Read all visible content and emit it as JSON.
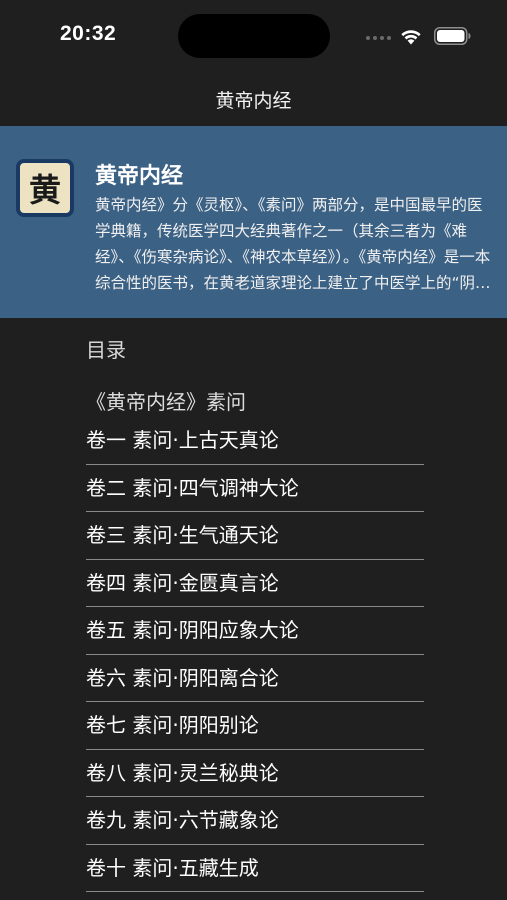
{
  "status_bar": {
    "time": "20:32"
  },
  "nav": {
    "title": "黄帝内经"
  },
  "book": {
    "icon_char": "黄",
    "title": "黄帝内经",
    "description": "黄帝内经》分《灵枢》、《素问》两部分，是中国最早的医学典籍，传统医学四大经典著作之一（其余三者为《难经》、《伤寒杂病论》、《神农本草经》）。《黄帝内经》是一本综合性的医书，在黄老道家理论上建立了中医学上的“阴阳五行学说”、“脉象学说”、“藏象学说”等。"
  },
  "toc": {
    "label": "目录",
    "section_title": "《黄帝内经》素问",
    "chapters": [
      "卷一 素问·上古天真论",
      "卷二 素问·四气调神大论",
      "卷三 素问·生气通天论",
      "卷四 素问·金匮真言论",
      "卷五 素问·阴阳应象大论",
      "卷六 素问·阴阳离合论",
      "卷七 素问·阴阳别论",
      "卷八 素问·灵兰秘典论",
      "卷九 素问·六节藏象论",
      "卷十 素问·五藏生成"
    ]
  },
  "icons": {
    "wifi": "wifi-icon",
    "battery": "battery-icon",
    "cellular": "cellular-signal-icon"
  },
  "colors": {
    "background": "#1f1f1f",
    "header_blue": "#3b6185",
    "icon_border": "#1b3a63",
    "icon_fill": "#ede3c3"
  }
}
